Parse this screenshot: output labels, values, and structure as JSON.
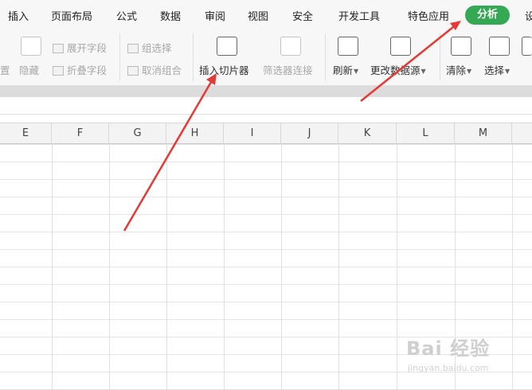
{
  "menu": {
    "tabs": [
      "插入",
      "页面布局",
      "公式",
      "数据",
      "审阅",
      "视图",
      "安全",
      "开发工具",
      "特色应用"
    ],
    "active_tab": "分析",
    "cut_tab": "设"
  },
  "ribbon": {
    "cut_left": "置",
    "hide": "隐藏",
    "expand_field": "展开字段",
    "collapse_field": "折叠字段",
    "group_select": "组选择",
    "ungroup": "取消组合",
    "insert_slicer": "插入切片器",
    "filter_connection": "筛选器连接",
    "refresh": "刷新",
    "change_source": "更改数据源",
    "clear": "清除",
    "select": "选择"
  },
  "columns": [
    "E",
    "F",
    "G",
    "H",
    "I",
    "J",
    "K",
    "L",
    "M"
  ],
  "watermark": {
    "brand": "Bai 经验",
    "url": "jingyan.baidu.com"
  },
  "colors": {
    "accent": "#34a853",
    "arrow": "#e53935"
  }
}
